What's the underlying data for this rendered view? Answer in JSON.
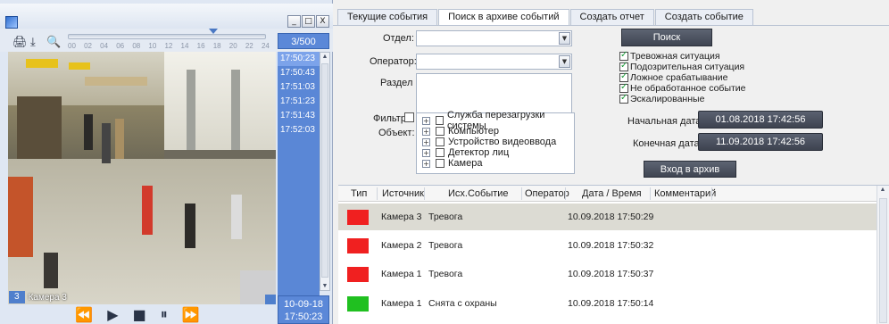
{
  "window": {
    "controls": [
      "_",
      "□",
      "X"
    ]
  },
  "toolbar": {
    "icons": [
      "print-icon",
      "download-icon",
      "zoom-icon"
    ],
    "timeline_ticks": [
      "00",
      "02",
      "04",
      "06",
      "08",
      "10",
      "12",
      "14",
      "16",
      "18",
      "20",
      "22",
      "24"
    ],
    "frame_counter": "3/500"
  },
  "camera": {
    "number": "3",
    "name": "Камера 3"
  },
  "time_list": [
    "17:50:23",
    "17:50:43",
    "17:51:03",
    "17:51:23",
    "17:51:43",
    "17:52:03"
  ],
  "date_box": {
    "date": "10-09-18",
    "time": "17:50:23"
  },
  "tabs": [
    "Текущие события",
    "Поиск в архиве событий",
    "Создать отчет",
    "Создать событие"
  ],
  "active_tab": 1,
  "form": {
    "department_label": "Отдел:",
    "operator_label": "Оператор:",
    "section_label": "Раздел",
    "filter_label": "Фильтр",
    "object_label": "Объект:",
    "search_button": "Поиск",
    "start_date_label": "Начальная дата:",
    "start_date": "01.08.2018 17:42:56",
    "end_date_label": "Конечная дата:",
    "end_date": "11.09.2018 17:42:56",
    "archive_button": "Вход в архив"
  },
  "tree": [
    "Служба перезагрузки системы",
    "Компьютер",
    "Устройство видеоввода",
    "Детектор лиц",
    "Камера"
  ],
  "checklist": [
    {
      "label": "Тревожная ситуация",
      "checked": true
    },
    {
      "label": "Подозрительная ситуация",
      "checked": true
    },
    {
      "label": "Ложное срабатывание",
      "checked": true
    },
    {
      "label": "Не обработанное событие",
      "checked": true
    },
    {
      "label": "Эскалированные",
      "checked": true
    }
  ],
  "grid": {
    "columns": [
      "Тип",
      "Источник",
      "Исх.Событие",
      "Оператор",
      "Дата / Время",
      "Комментарий"
    ],
    "rows": [
      {
        "color": "#f02020",
        "source": "Камера 3",
        "event": "Тревога",
        "operator": "",
        "datetime": "10.09.2018 17:50:29",
        "comment": ""
      },
      {
        "color": "#f02020",
        "source": "Камера 2",
        "event": "Тревога",
        "operator": "",
        "datetime": "10.09.2018 17:50:32",
        "comment": ""
      },
      {
        "color": "#f02020",
        "source": "Камера 1",
        "event": "Тревога",
        "operator": "",
        "datetime": "10.09.2018 17:50:37",
        "comment": ""
      },
      {
        "color": "#20c020",
        "source": "Камера 1",
        "event": "Снята с охраны",
        "operator": "",
        "datetime": "10.09.2018 17:50:14",
        "comment": ""
      }
    ]
  },
  "playback": [
    "rewind-icon",
    "play-icon",
    "stop-icon",
    "pause-icon",
    "fast-forward-icon"
  ]
}
